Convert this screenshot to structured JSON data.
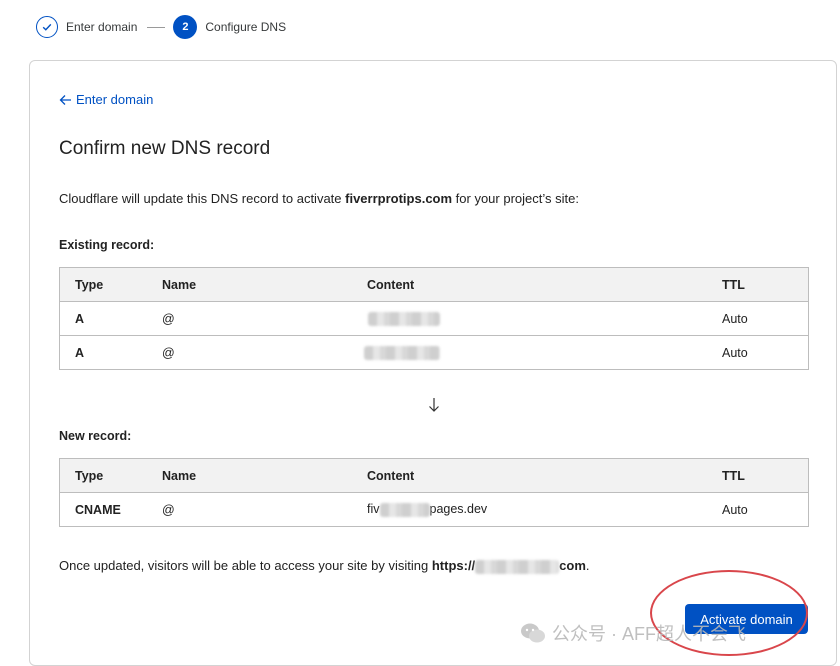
{
  "stepper": {
    "steps": [
      {
        "number": "",
        "label": "Enter domain",
        "state": "done"
      },
      {
        "number": "2",
        "label": "Configure DNS",
        "state": "active"
      }
    ]
  },
  "back_link": "Enter domain",
  "heading": "Confirm new DNS record",
  "intro": {
    "before": "Cloudflare will update this DNS record to activate ",
    "domain": "fiverrprotips.com",
    "after": " for your project’s site:"
  },
  "existing": {
    "label": "Existing record:",
    "columns": [
      "Type",
      "Name",
      "Content",
      "TTL"
    ],
    "rows": [
      {
        "type": "A",
        "name": "@",
        "content": "",
        "ttl": "Auto"
      },
      {
        "type": "A",
        "name": "@",
        "content": "",
        "ttl": "Auto"
      }
    ]
  },
  "new_record": {
    "label": "New record:",
    "columns": [
      "Type",
      "Name",
      "Content",
      "TTL"
    ],
    "rows": [
      {
        "type": "CNAME",
        "name": "@",
        "content_prefix": "fiv",
        "content_suffix": "pages.dev",
        "ttl": "Auto"
      }
    ]
  },
  "footer": {
    "before": "Once updated, visitors will be able to access your site by visiting ",
    "url_start": "https://",
    "url_end": "com",
    "after": "."
  },
  "activate_button": "Activate domain",
  "watermark": "公众号 · AFF超人不会飞",
  "colors": {
    "accent": "#0051c3",
    "annotation": "#d9464b"
  }
}
